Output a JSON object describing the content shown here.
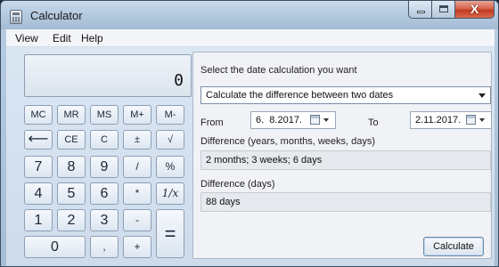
{
  "window": {
    "title": "Calculator"
  },
  "menu": [
    "View",
    "Edit",
    "Help"
  ],
  "display": {
    "value": "0"
  },
  "keypad": {
    "mc": "MC",
    "mr": "MR",
    "ms": "MS",
    "mplus": "M+",
    "mminus": "M-",
    "backspace": "⟵",
    "ce": "CE",
    "c": "C",
    "plusminus": "±",
    "sqrt": "√",
    "n7": "7",
    "n8": "8",
    "n9": "9",
    "divide": "/",
    "percent": "%",
    "n4": "4",
    "n5": "5",
    "n6": "6",
    "multiply": "*",
    "reciprocal": "1/x",
    "n1": "1",
    "n2": "2",
    "n3": "3",
    "minus": "-",
    "equals": "=",
    "n0": "0",
    "decimal": ",",
    "plus": "+"
  },
  "date_panel": {
    "heading": "Select the date calculation you want",
    "mode": "Calculate the difference between two dates",
    "from_label": "From",
    "from_value": "6.  8.2017.",
    "to_label": "To",
    "to_value": "2.11.2017.",
    "diff_ymwd_label": "Difference (years, months, weeks, days)",
    "diff_ymwd_value": "2 months; 3 weeks; 6 days",
    "diff_days_label": "Difference (days)",
    "diff_days_value": "88 days",
    "calculate_label": "Calculate"
  }
}
